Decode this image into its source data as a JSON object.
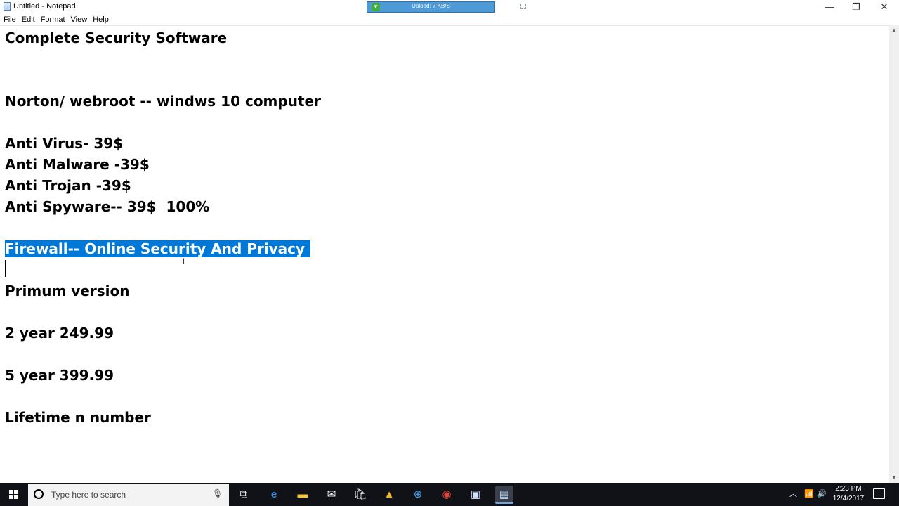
{
  "window": {
    "title": "Untitled - Notepad",
    "minimize_glyph": "—",
    "maximize_glyph": "❐",
    "close_glyph": "✕"
  },
  "upload_widget": {
    "text": "Upload: 7 KB/S"
  },
  "menu": {
    "items": [
      "File",
      "Edit",
      "Format",
      "View",
      "Help"
    ]
  },
  "editor": {
    "lines": [
      "Complete Security Software",
      "Norton/ webroot -- windws 10 computer",
      "Anti Virus- 39$",
      "Anti Malware -39$",
      "Anti Trojan -39$",
      "Anti Spyware-- 39$  100%",
      "Firewall-- Online Security And Privacy",
      "Primum version",
      "2 year 249.99",
      "5 year 399.99",
      "Lifetime n number"
    ],
    "selected_line_index": 6,
    "selection_color": "#0078d7"
  },
  "taskbar": {
    "search_placeholder": "Type here to search",
    "clock_time": "2:23 PM",
    "clock_date": "12/4/2017",
    "apps": [
      "task-view-icon",
      "edge-icon",
      "file-explorer-icon",
      "mail-icon",
      "store-icon",
      "vlc-like-icon",
      "app-plus-icon",
      "chrome-icon",
      "snipping-tool-icon",
      "notepad-icon"
    ]
  }
}
